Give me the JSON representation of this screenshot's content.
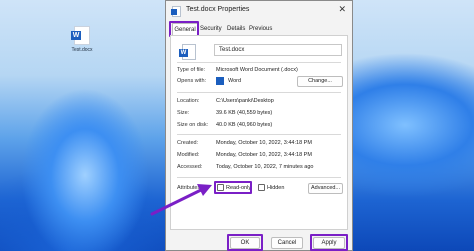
{
  "desktop": {
    "icon_label": "Test.docx"
  },
  "dialog": {
    "title": "Test.docx Properties",
    "close_glyph": "✕",
    "tabs": [
      {
        "label": "General"
      },
      {
        "label": "Security"
      },
      {
        "label": "Details"
      },
      {
        "label": "Previous Versions"
      }
    ],
    "file_name": "Test.docx",
    "rows": {
      "type_label": "Type of file:",
      "type_value": "Microsoft Word Document (.docx)",
      "opens_label": "Opens with:",
      "opens_value": "Word",
      "change_button": "Change...",
      "location_label": "Location:",
      "location_value": "C:\\Users\\panki\\Desktop",
      "size_label": "Size:",
      "size_value": "39.6 KB (40,559 bytes)",
      "size_disk_label": "Size on disk:",
      "size_disk_value": "40.0 KB (40,960 bytes)",
      "created_label": "Created:",
      "created_value": "Monday, October 10, 2022, 3:44:18 PM",
      "modified_label": "Modified:",
      "modified_value": "Monday, October 10, 2022, 3:44:18 PM",
      "accessed_label": "Accessed:",
      "accessed_value": "Today, October 10, 2022, 7 minutes ago",
      "attributes_label": "Attributes:",
      "readonly_label": "Read-only",
      "hidden_label": "Hidden",
      "advanced_button": "Advanced..."
    },
    "buttons": {
      "ok": "OK",
      "cancel": "Cancel",
      "apply": "Apply"
    }
  },
  "colors": {
    "highlight": "#7a1fc6",
    "word_blue": "#1b5ebe"
  },
  "icons": [
    "word-document-icon",
    "close-icon",
    "arrow-annotation"
  ]
}
